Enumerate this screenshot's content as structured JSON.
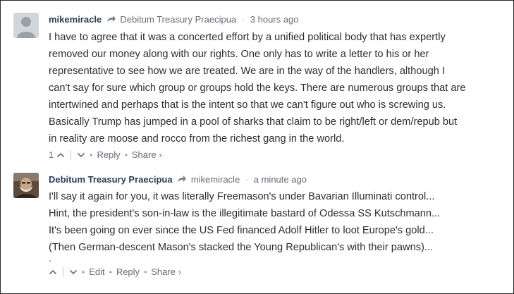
{
  "comments": [
    {
      "author": "mikemiracle",
      "reply_to": "Debitum Treasury Praecipua",
      "time": "3 hours ago",
      "lines": [
        "I have to agree that it was a concerted effort by a unified political body that has expertly",
        "removed our money along with our rights. One only has to write a letter to his or her",
        "representative to see how we are treated. We are in the way of the handlers, although I",
        "can't say for sure which group or groups hold the keys. There are numerous groups that are",
        "intertwined and perhaps that is the intent so that we can't figure out who is screwing us.",
        "Basically Trump has jumped in a pool of sharks that claim to be right/left or dem/repub but",
        "in reality are moose and rocco from the richest gang in the world."
      ],
      "upvotes": "1",
      "actions": {
        "reply": "Reply",
        "share": "Share ›"
      }
    },
    {
      "author": "Debitum Treasury Praecipua",
      "reply_to": "mikemiracle",
      "time": "a minute ago",
      "lines": [
        "I'll say it again for you, it was literally Freemason's under Bavarian Illuminati control...",
        "Hint, the president's son-in-law is the illegitimate bastard of Odessa SS Kutschmann...",
        "It's been going on ever since the US Fed financed Adolf Hitler to loot Europe's gold...",
        "(Then German-descent Mason's stacked the Young Republican's with their pawns)..."
      ],
      "trailing_dot": ".",
      "actions": {
        "edit": "Edit",
        "reply": "Reply",
        "share": "Share ›"
      }
    }
  ],
  "separators": {
    "dot": "·",
    "bullet": "•"
  }
}
